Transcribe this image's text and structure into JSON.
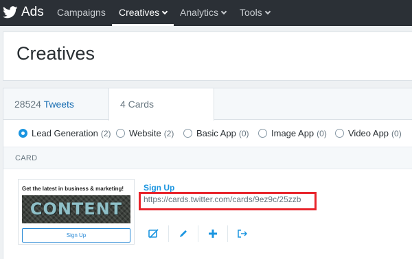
{
  "nav": {
    "brand": "Ads",
    "items": [
      {
        "label": "Campaigns",
        "dropdown": false,
        "active": false
      },
      {
        "label": "Creatives",
        "dropdown": true,
        "active": true
      },
      {
        "label": "Analytics",
        "dropdown": true,
        "active": false
      },
      {
        "label": "Tools",
        "dropdown": true,
        "active": false
      }
    ]
  },
  "page": {
    "title": "Creatives"
  },
  "tabs": {
    "tweets": {
      "count": "28524",
      "label": "Tweets"
    },
    "cards": {
      "label": "4 Cards"
    }
  },
  "filters": [
    {
      "label": "Lead Generation",
      "count": "(2)",
      "selected": true
    },
    {
      "label": "Website",
      "count": "(2)",
      "selected": false
    },
    {
      "label": "Basic App",
      "count": "(0)",
      "selected": false
    },
    {
      "label": "Image App",
      "count": "(0)",
      "selected": false
    },
    {
      "label": "Video App",
      "count": "(0)",
      "selected": false
    }
  ],
  "table": {
    "column_header": "CARD"
  },
  "card": {
    "preview": {
      "headline": "Get the latest in business & marketing!",
      "image_text": "CONTENT",
      "button": "Sign Up"
    },
    "title": "Sign Up",
    "url": "https://cards.twitter.com/cards/9ez9c/25zzb"
  },
  "actions": [
    "no-tweet-icon",
    "edit-icon",
    "add-icon",
    "share-icon"
  ],
  "colors": {
    "nav_bg": "#2b3036",
    "accent": "#1b95e0",
    "highlight": "#e8232a"
  }
}
